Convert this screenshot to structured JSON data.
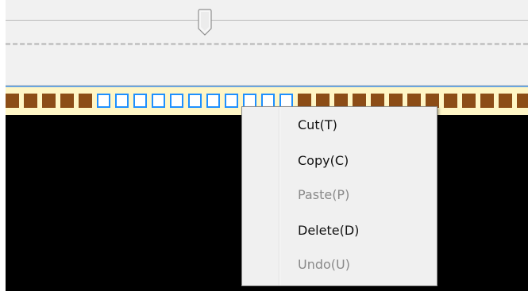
{
  "timeline": {
    "frame_states": [
      "filled",
      "filled",
      "filled",
      "filled",
      "filled",
      "selected",
      "selected",
      "selected",
      "selected",
      "selected",
      "selected",
      "selected",
      "selected",
      "selected",
      "selected",
      "selected",
      "filled",
      "filled",
      "filled",
      "filled",
      "filled",
      "filled",
      "filled",
      "filled",
      "filled",
      "filled",
      "filled",
      "filled",
      "filled",
      "filled",
      "filled"
    ]
  },
  "colors": {
    "panel_bg": "#f1f1f1",
    "strip_bg": "#fff6c6",
    "frame_fill": "#8c4d17",
    "frame_selected_border": "#1e90ff",
    "menu_bg": "#f0f0f0",
    "menu_disabled_text": "#8a8a8a"
  },
  "context_menu": {
    "items": [
      {
        "label": "Cut(T)",
        "enabled": true
      },
      {
        "label": "Copy(C)",
        "enabled": true
      },
      {
        "label": "Paste(P)",
        "enabled": false
      },
      {
        "label": "Delete(D)",
        "enabled": true
      },
      {
        "label": "Undo(U)",
        "enabled": false
      }
    ]
  }
}
